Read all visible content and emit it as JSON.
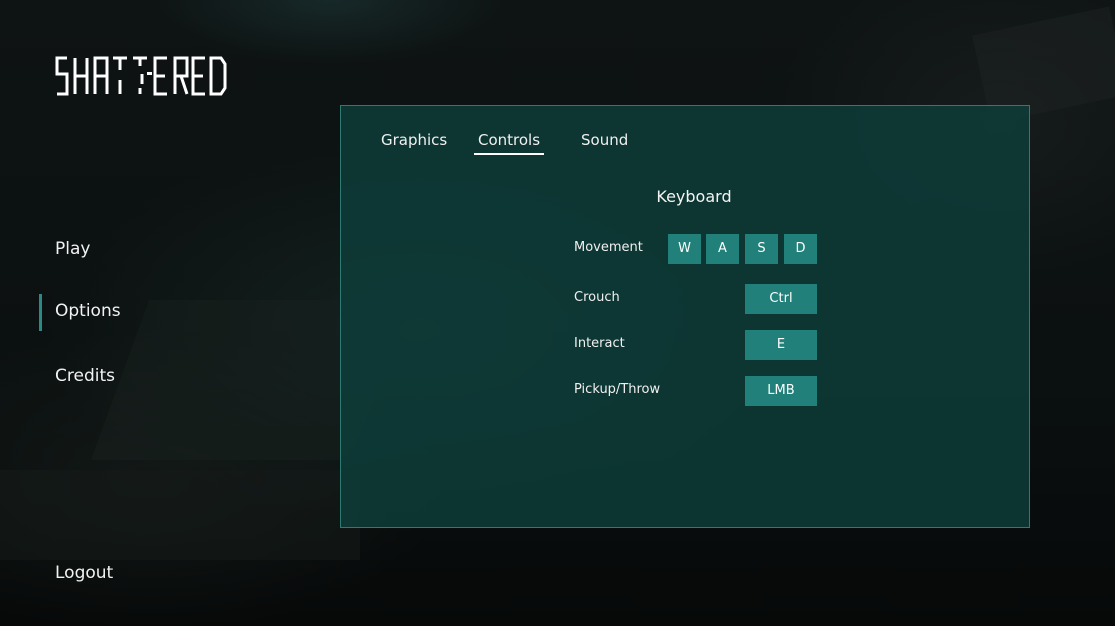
{
  "logo": {
    "text": "SHATTERED"
  },
  "nav": {
    "play": "Play",
    "options": "Options",
    "credits": "Credits",
    "logout": "Logout",
    "active": "Options"
  },
  "tabs": {
    "graphics": "Graphics",
    "controls": "Controls",
    "sound": "Sound",
    "active": "Controls"
  },
  "controls": {
    "section_title": "Keyboard",
    "rows": [
      {
        "label": "Movement",
        "keys": [
          "W",
          "A",
          "S",
          "D"
        ]
      },
      {
        "label": "Crouch",
        "keys": [
          "Ctrl"
        ]
      },
      {
        "label": "Interact",
        "keys": [
          "E"
        ]
      },
      {
        "label": "Pickup/Throw",
        "keys": [
          "LMB"
        ]
      }
    ]
  },
  "colors": {
    "panel_bg": "#0e3e3a",
    "panel_border": "#2c7b75",
    "key_bg": "#218079",
    "accent": "#2a8a86",
    "text": "#ffffff"
  }
}
